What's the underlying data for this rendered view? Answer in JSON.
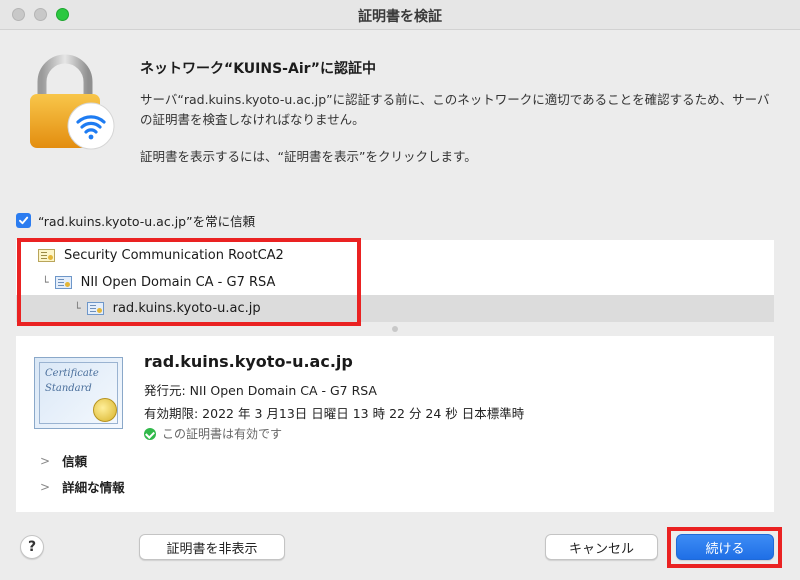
{
  "window": {
    "title": "証明書を検証"
  },
  "header": {
    "heading": "ネットワーク“KUINS-Air”に認証中",
    "description": "サーバ“rad.kuins.kyoto-u.ac.jp”に認証する前に、このネットワークに適切であることを確認するため、サーバの証明書を検査しなければなりません。",
    "hint": "証明書を表示するには、“証明書を表示”をクリックします。"
  },
  "trust_checkbox": {
    "label": "“rad.kuins.kyoto-u.ac.jp”を常に信頼",
    "checked": true
  },
  "chain": {
    "items": [
      {
        "label": "Security Communication RootCA2"
      },
      {
        "label": "NII Open Domain CA - G7 RSA"
      },
      {
        "label": "rad.kuins.kyoto-u.ac.jp"
      }
    ]
  },
  "certificate": {
    "badge_text_1": "Certificate",
    "badge_text_2": "Standard",
    "common_name": "rad.kuins.kyoto-u.ac.jp",
    "issuer": "発行元: NII Open Domain CA - G7 RSA",
    "expires": "有効期限: 2022 年 3 月13日 日曜日 13 時 22 分 24 秒 日本標準時",
    "status": "この証明書は有効です"
  },
  "sections": {
    "trust": "信頼",
    "details": "詳細な情報"
  },
  "buttons": {
    "help": "?",
    "hide_cert": "証明書を非表示",
    "cancel": "キャンセル",
    "continue": "続ける"
  },
  "colors": {
    "accent": "#2b7cf0",
    "highlight": "#ea2222",
    "valid": "#31b94a"
  }
}
